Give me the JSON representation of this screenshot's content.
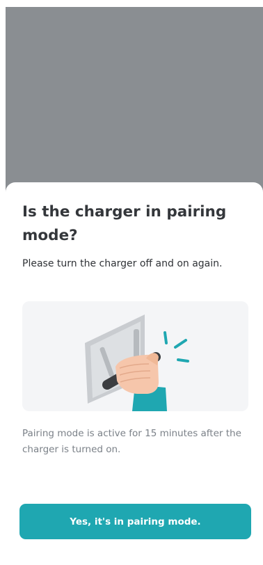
{
  "modal": {
    "title": "Is the charger in pairing mode?",
    "subtitle": "Please turn the charger off and on again.",
    "illustration_icon": "hand-switch-icon",
    "note": "Pairing mode is active for 15 minutes after the charger is turned on.",
    "confirm_label": "Yes, it's in pairing mode."
  },
  "colors": {
    "accent": "#1fa7b1",
    "overlay": "#8a8e92",
    "title": "#34373b",
    "note": "#7b8188"
  }
}
